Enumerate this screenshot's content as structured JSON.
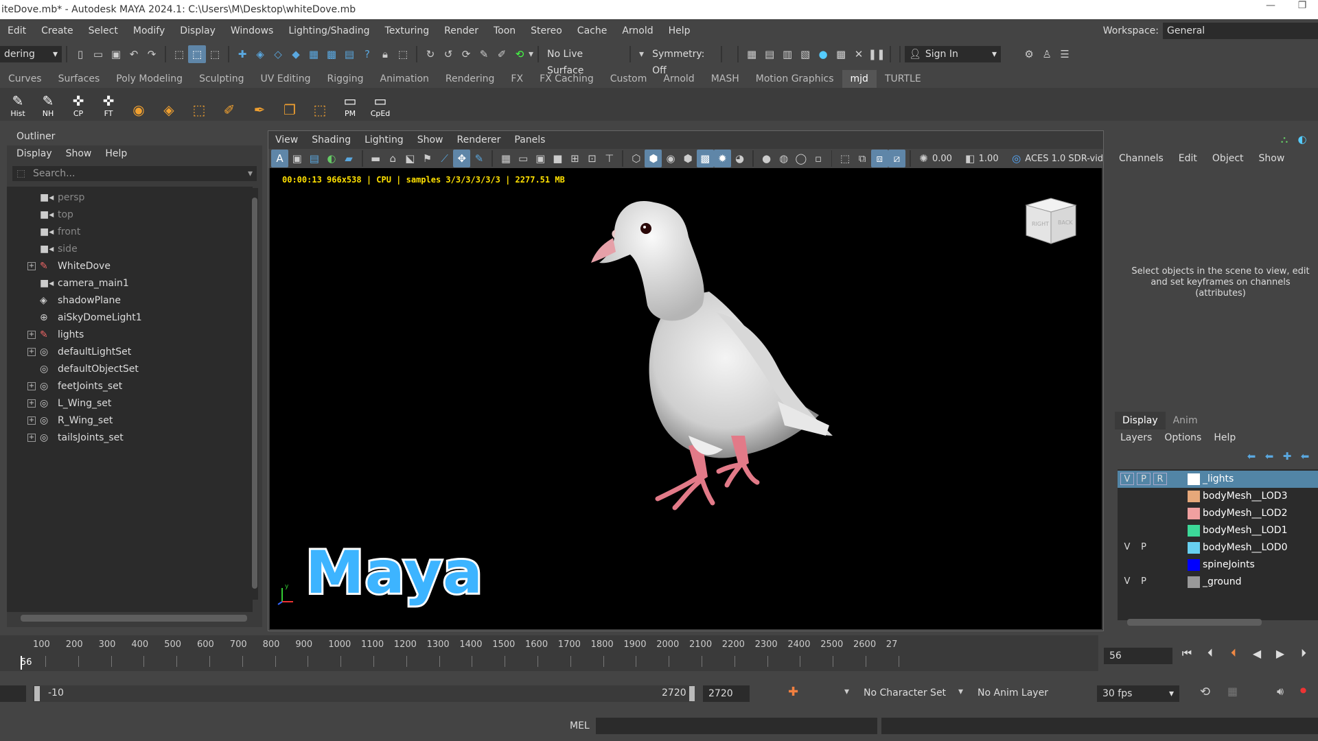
{
  "window": {
    "title": "iteDove.mb* - Autodesk MAYA 2024.1: C:\\Users\\M\\Desktop\\whiteDove.mb",
    "minimize": "—",
    "restore": "❐"
  },
  "menubar": {
    "items": [
      "Edit",
      "Create",
      "Select",
      "Modify",
      "Display",
      "Windows",
      "Lighting/Shading",
      "Texturing",
      "Render",
      "Toon",
      "Stereo",
      "Cache",
      "Arnold",
      "Help"
    ],
    "workspace_label": "Workspace:",
    "workspace_value": "General"
  },
  "statusline": {
    "menuset": "dering",
    "live_surface": "No Live Surface",
    "symmetry": "Symmetry: Off",
    "sign_in": "Sign In"
  },
  "shelf": {
    "tabs": [
      "Curves",
      "Surfaces",
      "Poly Modeling",
      "Sculpting",
      "UV Editing",
      "Rigging",
      "Animation",
      "Rendering",
      "FX",
      "FX Caching",
      "Custom",
      "Arnold",
      "MASH",
      "Motion Graphics",
      "mjd",
      "TURTLE"
    ],
    "active_tab": "mjd",
    "buttons": [
      {
        "label": "Hist",
        "icon": "hist-icon"
      },
      {
        "label": "NH",
        "icon": "nh-icon"
      },
      {
        "label": "CP",
        "icon": "cp-icon"
      },
      {
        "label": "FT",
        "icon": "ft-icon"
      },
      {
        "label": "",
        "icon": "layers-icon"
      },
      {
        "label": "",
        "icon": "stack-icon"
      },
      {
        "label": "",
        "icon": "boxes-icon"
      },
      {
        "label": "",
        "icon": "brush-icon"
      },
      {
        "label": "",
        "icon": "pen-icon"
      },
      {
        "label": "",
        "icon": "copy-icon"
      },
      {
        "label": "",
        "icon": "select-box-icon"
      },
      {
        "label": "PM",
        "icon": "pm-icon"
      },
      {
        "label": "CpEd",
        "icon": "cped-icon"
      }
    ]
  },
  "outliner": {
    "title": "Outliner",
    "menu": [
      "Display",
      "Show",
      "Help"
    ],
    "search_placeholder": "Search...",
    "items": [
      {
        "label": "persp",
        "icon": "camera",
        "expand": false,
        "dim": true
      },
      {
        "label": "top",
        "icon": "camera",
        "expand": false,
        "dim": true
      },
      {
        "label": "front",
        "icon": "camera",
        "expand": false,
        "dim": true
      },
      {
        "label": "side",
        "icon": "camera",
        "expand": false,
        "dim": true
      },
      {
        "label": "WhiteDove",
        "icon": "group",
        "expand": true,
        "dim": false
      },
      {
        "label": "camera_main1",
        "icon": "camera",
        "expand": false,
        "dim": false
      },
      {
        "label": "shadowPlane",
        "icon": "plane",
        "expand": false,
        "dim": false
      },
      {
        "label": "aiSkyDomeLight1",
        "icon": "dome",
        "expand": false,
        "dim": false
      },
      {
        "label": "lights",
        "icon": "group",
        "expand": true,
        "dim": false
      },
      {
        "label": "defaultLightSet",
        "icon": "set",
        "expand": true,
        "dim": false
      },
      {
        "label": "defaultObjectSet",
        "icon": "set",
        "expand": false,
        "dim": false
      },
      {
        "label": "feetJoints_set",
        "icon": "set",
        "expand": true,
        "dim": false
      },
      {
        "label": "L_Wing_set",
        "icon": "set",
        "expand": true,
        "dim": false
      },
      {
        "label": "R_Wing_set",
        "icon": "set",
        "expand": true,
        "dim": false
      },
      {
        "label": "tailsJoints_set",
        "icon": "set",
        "expand": true,
        "dim": false
      }
    ]
  },
  "viewport": {
    "menu": [
      "View",
      "Shading",
      "Lighting",
      "Show",
      "Renderer",
      "Panels"
    ],
    "exposure": "0.00",
    "gamma": "1.00",
    "color_space": "ACES 1.0 SDR-vid",
    "hud": "00:00:13 966x538 | CPU | samples 3/3/3/3/3/3 | 2277.51 MB",
    "logo": "Maya",
    "viewcube_right": "RIGHT",
    "viewcube_back": "BACK"
  },
  "channels": {
    "menu": [
      "Channels",
      "Edit",
      "Object",
      "Show"
    ],
    "message": "Select objects in the scene to view, edit and set keyframes on channels (attributes)"
  },
  "layers": {
    "tabs": [
      "Display",
      "Anim"
    ],
    "menu": [
      "Layers",
      "Options",
      "Help"
    ],
    "rows": [
      {
        "v": "V",
        "p": "P",
        "r": "R",
        "color": "#ffffff",
        "name": "_lights",
        "selected": true
      },
      {
        "v": "",
        "p": "",
        "r": "",
        "color": "#e6a87a",
        "name": "bodyMesh__LOD3",
        "selected": false
      },
      {
        "v": "",
        "p": "",
        "r": "",
        "color": "#f0a0a0",
        "name": "bodyMesh__LOD2",
        "selected": false
      },
      {
        "v": "",
        "p": "",
        "r": "",
        "color": "#3cd898",
        "name": "bodyMesh__LOD1",
        "selected": false
      },
      {
        "v": "V",
        "p": "P",
        "r": "",
        "color": "#68d0f0",
        "name": "bodyMesh__LOD0",
        "selected": false
      },
      {
        "v": "",
        "p": "",
        "r": "",
        "color": "#0000ff",
        "name": "spineJoints",
        "selected": false
      },
      {
        "v": "V",
        "p": "P",
        "r": "",
        "color": "#999999",
        "name": "_ground",
        "selected": false
      }
    ]
  },
  "timeline": {
    "ticks": [
      "100",
      "200",
      "300",
      "400",
      "500",
      "600",
      "700",
      "800",
      "900",
      "1000",
      "1100",
      "1200",
      "1300",
      "1400",
      "1500",
      "1600",
      "1700",
      "1800",
      "1900",
      "2000",
      "2100",
      "2200",
      "2300",
      "2400",
      "2500",
      "2600",
      "27"
    ],
    "current_frame": "56",
    "current_frame_field": "56"
  },
  "range": {
    "start": "-10",
    "end": "2720",
    "end_field": "2720",
    "character_set": "No Character Set",
    "anim_layer": "No Anim Layer",
    "fps": "30 fps"
  },
  "cmdline": {
    "label": "MEL"
  }
}
